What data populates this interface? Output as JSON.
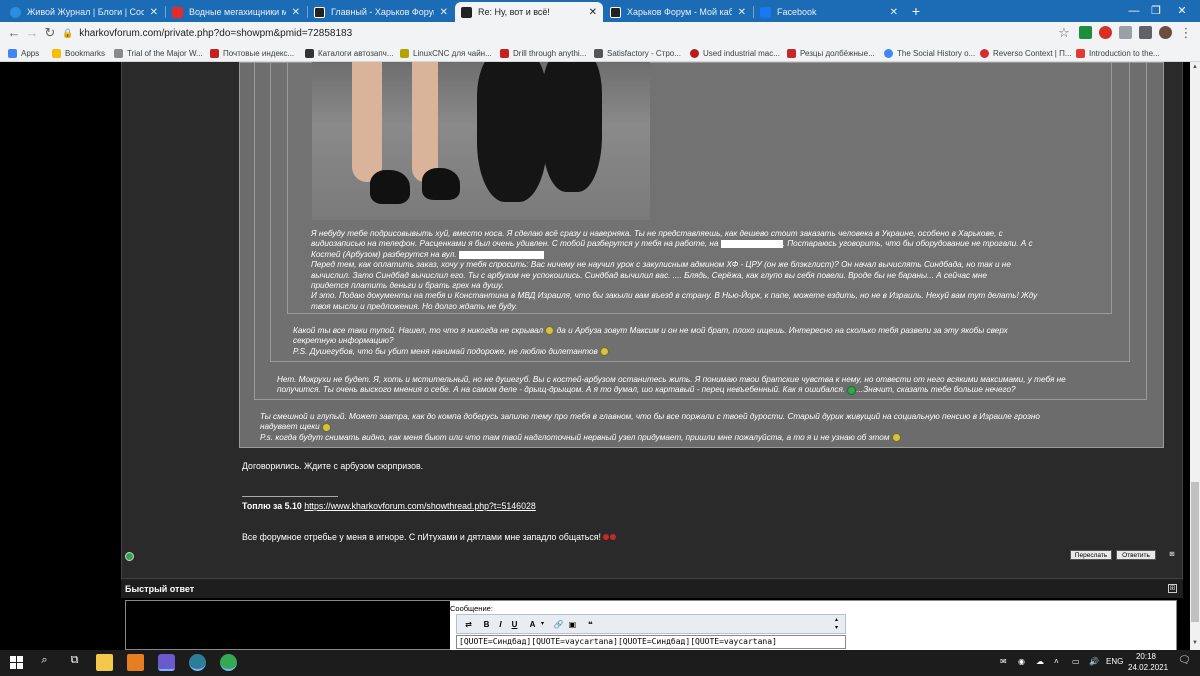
{
  "browser": {
    "tabs": [
      {
        "title": "Живой Журнал | Блоги | Сообщ",
        "color": "#2a8de0"
      },
      {
        "title": "Водные мегахищники мезозоя",
        "color": "#e22b2b"
      },
      {
        "title": "Главный - Харьков Форум",
        "color": "#222222"
      },
      {
        "title": "Re: Ну, вот и всё!",
        "color": "#222222"
      },
      {
        "title": "Харьков Форум - Мой кабинет",
        "color": "#222222"
      },
      {
        "title": "Facebook",
        "color": "#1877f2"
      }
    ],
    "new_tab": "+",
    "url": "kharkovforum.com/private.php?do=showpm&pmid=72858183",
    "bookmarks": [
      "Apps",
      "Bookmarks",
      "Trial of the Major W...",
      "Почтовые индекс...",
      "Каталоги автозапч...",
      "LinuxCNC для чайн...",
      "Drill through anythi...",
      "Satisfactory - Стро...",
      "Used industrial mac...",
      "Резцы долбёжные...",
      "The Social History o...",
      "Reverso Context | П...",
      "Introduction to the..."
    ]
  },
  "post": {
    "quote_inner": [
      "Я небуду тебе подрисовывыть хуй, вместо носа. Я сделаю всё сразу и наверняка. Ты не представляешь, как дешево стоит заказать человека в Украине, особено в Харькове, с",
      "видиозаписью на телефон. Расценками я был очень удивлен. С тобой разберутся у тебя на работе, на",
      "Костей (Арбузом) разберутся на вул.",
      "Перед тем, как оплатить заказ, хочу у тебя спросить: Вас ничему не научил урок с закулисным админом ХФ - ЦРУ (он же блэкглист)? Он начал вычислять Синдбада, но так и не",
      "вычислил. Зато Синдбад вычислил его. Ты с арбузом не успокоились. Синдбад вычилил вас. .... Блядь, Серёжа, как глупо вы себя повели. Вроде бы не бараны... А сейчас мне",
      "придется платить деньги и брать грех на душу.",
      "И это. Подаю документы на тебя и Константина в МВД Израиля, что бы закыли вам въезд в страну. В Нью-Йорк, к папе, можете ездить, но не в Израиль. Нехуй вам тут делать! Жду",
      "твоя мысли и предложения. Но долго ждать не буду."
    ],
    "quote_inner_tail": ". Постараюсь уговорить, что бы оборудование не трогали. А с",
    "quote_level3": [
      "Какой ты все таки тупой. Нашел, то что я никогда не скрывал",
      " да и Арбуза зовут Максим и он не мой брат, плохо ищешь. Интересно на сколько тебя развели за эту якобы сверх",
      "секретную информацию?",
      "P.S. Душегубов, что бы убит меня нанимай подороже, не люблю дилетантов"
    ],
    "quote_level2": [
      "Нет. Мокрухи не будет. Я, хоть и мстительный, но не душегуб. Вы с костей-арбузом останитесь жить. Я понимаю твои братские чувства к нему, но отвести от него всякими максимами, у тебя не",
      "получится. Ты очень выского мнения о себе. А на самом деле - дрыщ-дрыщом. А я то думал, шо картавый - перец невъебенный. Как я ошибался.",
      "...Значит, сказать тебе больше нечего?"
    ],
    "quote_level1": [
      "Ты смешной и глупый. Может завтра, как до компа доберусь запилю тему про тебя в главном, что бы все поржали с твоей дурости. Старый дурик живущий на социальную пенсию в Израиле грозно",
      "надувает щеки",
      "P.s. когда будут снимать видно, как меня бьют или что там твой надглоточный нервный узел придумает, пришли мне пожалуйста, а то я и не узнаю об этом"
    ],
    "reply": "Договорились. Ждите с арбузом сюрпризов.",
    "sig_bold": "Топлю за 5.10",
    "sig_link": "https://www.kharkovforum.com/showthread.php?t=5146028",
    "sig_footer": "Все форумное отребье у меня в игноре. С пИтухами и дятлами мне западло общаться!",
    "btn_forward": "Переслать",
    "btn_reply": "Ответить"
  },
  "quick_reply": {
    "title": "Быстрый ответ",
    "label": "Сообщение:",
    "text": "[QUOTE=Синдбад][QUOTE=vaycartana][QUOTE=Синдбад][QUOTE=vaycartana]"
  },
  "taskbar": {
    "lang": "ENG",
    "time": "20:18",
    "date": "24.02.2021"
  }
}
